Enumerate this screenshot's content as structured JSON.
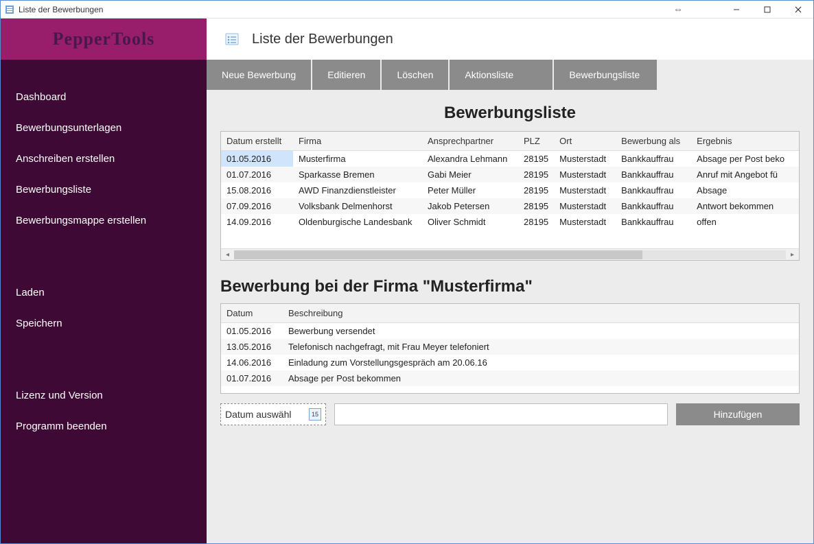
{
  "window": {
    "title": "Liste der Bewerbungen"
  },
  "brand": "PepperTools",
  "sidebar": {
    "group1": [
      "Dashboard",
      "Bewerbungsunterlagen",
      "Anschreiben erstellen",
      "Bewerbungsliste",
      "Bewerbungsmappe erstellen"
    ],
    "group2": [
      "Laden",
      "Speichern"
    ],
    "group3": [
      "Lizenz und Version",
      "Programm beenden"
    ]
  },
  "page_title": "Liste der Bewerbungen",
  "toolbar": {
    "neu": "Neue Bewerbung",
    "edit": "Editieren",
    "del": "Löschen",
    "aktion": "Aktionsliste",
    "bewerb": "Bewerbungsliste"
  },
  "list_title": "Bewerbungsliste",
  "columns": {
    "datum": "Datum erstellt",
    "firma": "Firma",
    "ansprech": "Ansprechpartner",
    "plz": "PLZ",
    "ort": "Ort",
    "als": "Bewerbung als",
    "erg": "Ergebnis"
  },
  "rows": [
    {
      "datum": "01.05.2016",
      "firma": "Musterfirma",
      "ansprech": "Alexandra Lehmann",
      "plz": "28195",
      "ort": "Musterstadt",
      "als": "Bankkauffrau",
      "erg": "Absage per Post beko"
    },
    {
      "datum": "01.07.2016",
      "firma": "Sparkasse Bremen",
      "ansprech": "Gabi Meier",
      "plz": "28195",
      "ort": "Musterstadt",
      "als": "Bankkauffrau",
      "erg": "Anruf mit Angebot fü"
    },
    {
      "datum": "15.08.2016",
      "firma": "AWD Finanzdienstleister",
      "ansprech": "Peter Müller",
      "plz": "28195",
      "ort": "Musterstadt",
      "als": "Bankkauffrau",
      "erg": "Absage"
    },
    {
      "datum": "07.09.2016",
      "firma": "Volksbank Delmenhorst",
      "ansprech": "Jakob Petersen",
      "plz": "28195",
      "ort": "Musterstadt",
      "als": "Bankkauffrau",
      "erg": "Antwort bekommen"
    },
    {
      "datum": "14.09.2016",
      "firma": "Oldenburgische Landesbank",
      "ansprech": "Oliver Schmidt",
      "plz": "28195",
      "ort": "Musterstadt",
      "als": "Bankkauffrau",
      "erg": "offen"
    }
  ],
  "detail_title": "Bewerbung bei der Firma \"Musterfirma\"",
  "detail_columns": {
    "datum": "Datum",
    "beschr": "Beschreibung"
  },
  "detail_rows": [
    {
      "datum": "01.05.2016",
      "beschr": "Bewerbung versendet"
    },
    {
      "datum": "13.05.2016",
      "beschr": "Telefonisch nachgefragt, mit Frau Meyer telefoniert"
    },
    {
      "datum": "14.06.2016",
      "beschr": "Einladung zum Vorstellungsgespräch am 20.06.16"
    },
    {
      "datum": "01.07.2016",
      "beschr": "Absage per Post bekommen"
    }
  ],
  "date_picker_placeholder": "Datum auswähl",
  "cal_day": "15",
  "add_button": "Hinzufügen"
}
